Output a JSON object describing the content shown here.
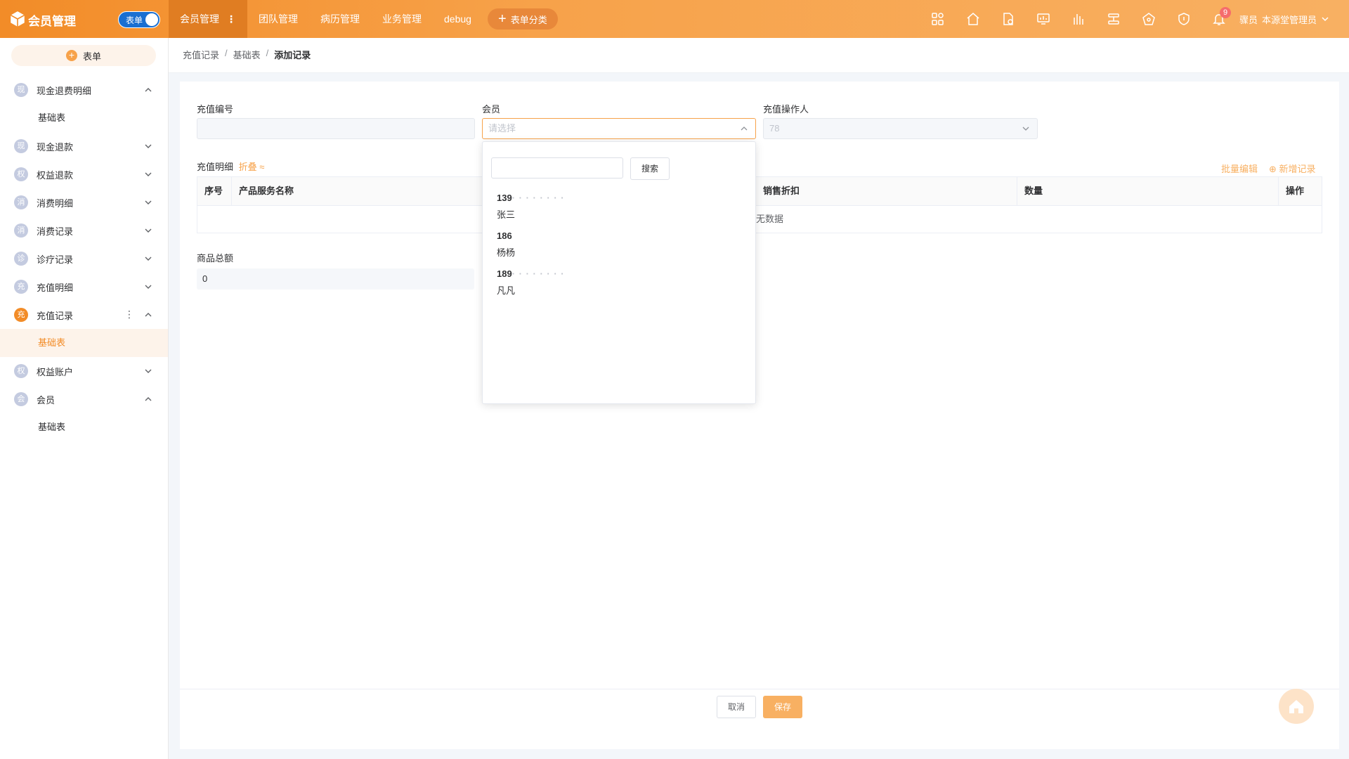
{
  "topbar": {
    "title": "会员管理",
    "toggle_label": "表单",
    "nav": [
      {
        "label": "会员管理",
        "active": true
      },
      {
        "label": "团队管理"
      },
      {
        "label": "病历管理"
      },
      {
        "label": "业务管理"
      },
      {
        "label": "debug"
      }
    ],
    "form_category_label": "表单分类",
    "icons": [
      "apps-icon",
      "home-icon",
      "document-settings-icon",
      "monitor-chart-icon",
      "bar-chart-icon",
      "list-flow-icon",
      "network-icon",
      "shield-icon",
      "bell-icon"
    ],
    "notification_count": "9",
    "user_org": "骤员",
    "user_name": "本源堂管理员"
  },
  "sidebar": {
    "add_form_label": "表单",
    "groups": [
      {
        "avatar": "现",
        "label": "现金退费明细",
        "expanded": true,
        "children": [
          "基础表"
        ]
      },
      {
        "avatar": "现",
        "label": "现金退款",
        "expanded": false
      },
      {
        "avatar": "权",
        "label": "权益退款",
        "expanded": false
      },
      {
        "avatar": "消",
        "label": "消费明细",
        "expanded": false
      },
      {
        "avatar": "消",
        "label": "消费记录",
        "expanded": false
      },
      {
        "avatar": "诊",
        "label": "诊疗记录",
        "expanded": false
      },
      {
        "avatar": "充",
        "label": "充值明细",
        "expanded": false
      },
      {
        "avatar": "充",
        "label": "充值记录",
        "expanded": true,
        "active": true,
        "children": [
          "基础表"
        ]
      },
      {
        "avatar": "权",
        "label": "权益账户",
        "expanded": false
      },
      {
        "avatar": "会",
        "label": "会员",
        "expanded": true,
        "children": [
          "基础表"
        ]
      }
    ]
  },
  "breadcrumb": [
    "充值记录",
    "基础表",
    "添加记录"
  ],
  "form": {
    "recharge_no_label": "充值编号",
    "recharge_no_value": "",
    "member_label": "会员",
    "member_placeholder": "请选择",
    "operator_label": "充值操作人",
    "operator_value": "78",
    "detail_title": "充值明细",
    "collapse_label": "折叠 ≈",
    "batch_edit_label": "批量编辑",
    "add_record_label": "⊕ 新增记录",
    "table_headers": [
      "序号",
      "产品服务名称",
      "销售折扣",
      "数量",
      "操作"
    ],
    "empty_text": "无数据",
    "total_label": "商品总额",
    "total_value": "0"
  },
  "dropdown": {
    "search_placeholder": "",
    "search_button": "搜索",
    "options": [
      {
        "phone": "139",
        "mask": "· · · · · · · ·",
        "name": "张三"
      },
      {
        "phone": "186",
        "mask": "",
        "name": "杨杨"
      },
      {
        "phone": "189",
        "mask": "· · · · · · · ·",
        "name": "凡凡"
      }
    ]
  },
  "footer": {
    "cancel_label": "取消",
    "save_label": "保存"
  },
  "colors": {
    "accent": "#f28c28",
    "accent_light": "#f8b062",
    "toggle_blue": "#1a6fd1",
    "badge_red": "#f56c6c"
  }
}
